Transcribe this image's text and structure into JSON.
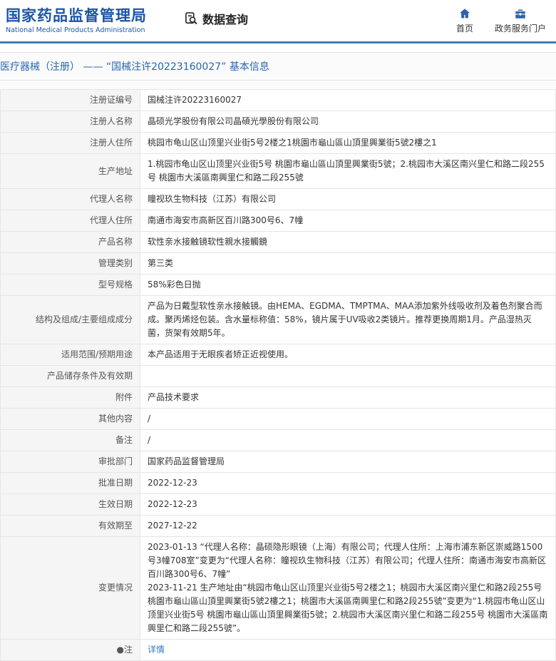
{
  "header": {
    "site_name": "国家药品监督管理局",
    "site_name_en": "National Medical Products Administration",
    "section_label": "数据查询",
    "nav": [
      {
        "label": "首页"
      },
      {
        "label": "政务服务门户"
      }
    ]
  },
  "page": {
    "title": "医疗器械（注册） ——  “国械注许20223160027”  基本信息"
  },
  "table": {
    "rows": [
      {
        "label": "注册证编号",
        "value": "国械注许20223160027"
      },
      {
        "label": "注册人名称",
        "value": "晶硕光学股份有限公司晶碩光學股份有限公司"
      },
      {
        "label": "注册人住所",
        "value": "桃园市龟山区山顶里兴业街5号2楼之1桃園市龜山區山頂里興業街5號2樓之1"
      },
      {
        "label": "生产地址",
        "value": "1.桃园市龟山区山顶里兴业街5号 桃園市龜山區山頂里興業街5號；2.桃园市大溪区南兴里仁和路二段255号 桃園市大溪區南興里仁和路二段255號"
      },
      {
        "label": "代理人名称",
        "value": "瞳视玖生物科技（江苏）有限公司"
      },
      {
        "label": "代理人住所",
        "value": "南通市海安市高新区百川路300号6、7幢"
      },
      {
        "label": "产品名称",
        "value": "软性亲水接触镜软性親水接觸鏡"
      },
      {
        "label": "管理类别",
        "value": "第三类"
      },
      {
        "label": "型号规格",
        "value": "58%彩色日抛"
      },
      {
        "label": "结构及组成/主要组成成分",
        "value": "产品为日戴型软性亲水接触镜。由HEMA、EGDMA、TMPTMA、MAA添加紫外线吸收剂及着色剂聚合而成。聚丙烯烃包装。含水量标称值：58%，镜片属于UV吸收2类镜片。推荐更换周期1月。产品湿热灭菌，货架有效期5年。"
      },
      {
        "label": "适用范围/预期用途",
        "value": "本产品适用于无眼疾者矫正近视使用。"
      },
      {
        "label": "产品储存条件及有效期",
        "value": ""
      },
      {
        "label": "附件",
        "value": "产品技术要求"
      },
      {
        "label": "其他内容",
        "value": "/"
      },
      {
        "label": "备注",
        "value": "/"
      },
      {
        "label": "审批部门",
        "value": "国家药品监督管理局"
      },
      {
        "label": "批准日期",
        "value": "2022-12-23"
      },
      {
        "label": "生效日期",
        "value": "2022-12-23"
      },
      {
        "label": "有效期至",
        "value": "2027-12-22"
      },
      {
        "label": "变更情况",
        "value": "2023-01-13 “代理人名称：晶硕隐形眼镜（上海）有限公司；代理人住所：上海市浦东新区崇威路1500号3幢708室”变更为“代理人名称：瞳视玖生物科技（江苏）有限公司；代理人住所：南通市海安市高新区百川路300号6、7幢”\n2023-11-21 生产地址由“桃园市龟山区山顶里兴业街5号2楼之1；桃园市大溪区南兴里仁和路2段255号 桃園市龜山區山頂里興業街5號2樓之1；桃園市大溪區南興里仁和路2段255號”变更为“1.桃园市龟山区山顶里兴业街5号 桃園市龜山區山頂里興業街5號；2.桃园市大溪区南兴里仁和路二段255号 桃園市大溪區南興里仁和路二段255號”。"
      },
      {
        "label": "●注",
        "value": "详情",
        "link": true
      }
    ]
  },
  "colors": {
    "brand_blue": "#1d55a7",
    "divider_blue": "#4a7ab5",
    "link_blue": "#2f7bc4"
  }
}
